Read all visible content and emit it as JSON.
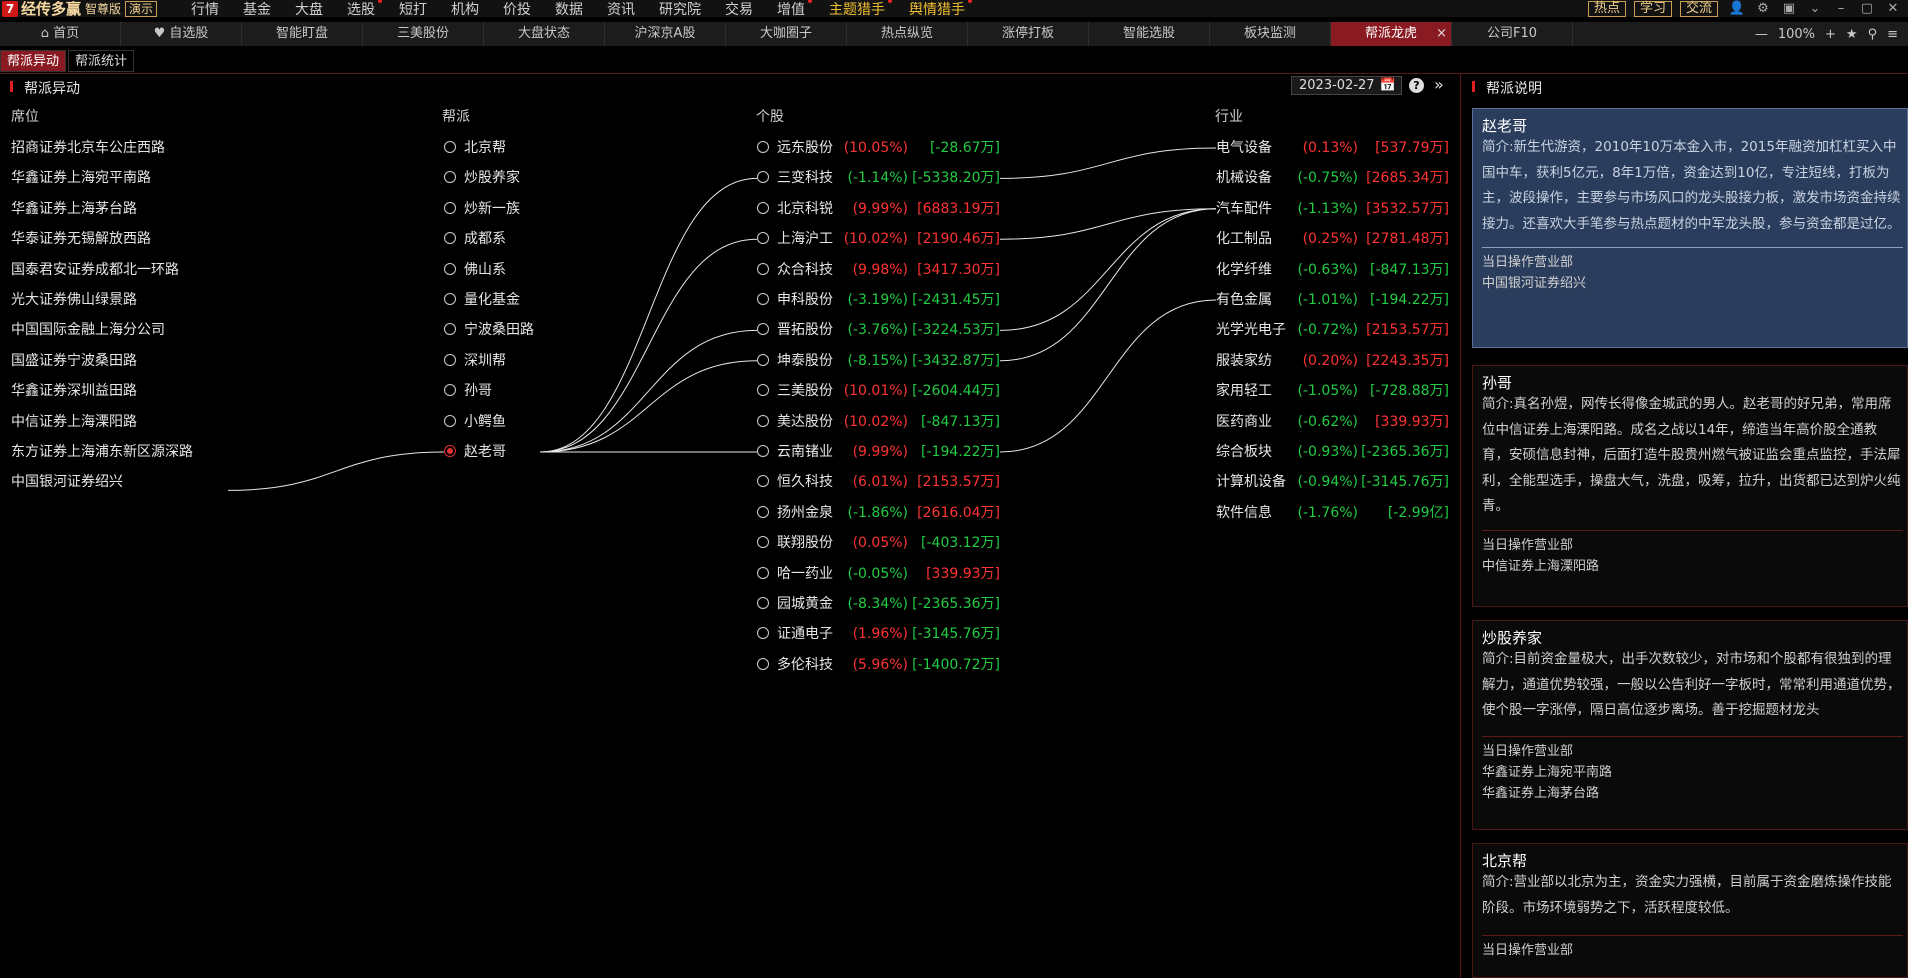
{
  "app": {
    "logo_mark": "7",
    "name": "经传多赢",
    "edition": "智尊版",
    "demo_label": "演示"
  },
  "menu": [
    {
      "label": "行情",
      "hot": false,
      "dot": false
    },
    {
      "label": "基金",
      "hot": false,
      "dot": false
    },
    {
      "label": "大盘",
      "hot": false,
      "dot": false
    },
    {
      "label": "选股",
      "hot": false,
      "dot": true
    },
    {
      "label": "短打",
      "hot": false,
      "dot": false
    },
    {
      "label": "机构",
      "hot": false,
      "dot": false
    },
    {
      "label": "价投",
      "hot": false,
      "dot": false
    },
    {
      "label": "数据",
      "hot": false,
      "dot": false
    },
    {
      "label": "资讯",
      "hot": false,
      "dot": false
    },
    {
      "label": "研究院",
      "hot": false,
      "dot": false
    },
    {
      "label": "交易",
      "hot": false,
      "dot": false
    },
    {
      "label": "增值",
      "hot": false,
      "dot": true
    },
    {
      "label": "主题猎手",
      "hot": true,
      "dot": true
    },
    {
      "label": "舆情猎手",
      "hot": true,
      "dot": true
    }
  ],
  "menu_right": {
    "buttons": [
      "热点",
      "学习",
      "交流"
    ]
  },
  "tabs": [
    {
      "label": "⌂ 首页",
      "active": false
    },
    {
      "label": "♥ 自选股",
      "active": false
    },
    {
      "label": "智能盯盘",
      "active": false
    },
    {
      "label": "三美股份",
      "active": false
    },
    {
      "label": "大盘状态",
      "active": false
    },
    {
      "label": "沪深京A股",
      "active": false
    },
    {
      "label": "大咖圈子",
      "active": false
    },
    {
      "label": "热点纵览",
      "active": false
    },
    {
      "label": "涨停打板",
      "active": false
    },
    {
      "label": "智能选股",
      "active": false
    },
    {
      "label": "板块监测",
      "active": false
    },
    {
      "label": "帮派龙虎",
      "active": true
    },
    {
      "label": "公司F10",
      "active": false
    }
  ],
  "tab_close": "×",
  "tab_zoom": "100%",
  "subtabs": [
    {
      "label": "帮派异动",
      "active": true
    },
    {
      "label": "帮派统计",
      "active": false
    }
  ],
  "panel": {
    "title": "帮派异动",
    "date": "2023-02-27",
    "help": "?",
    "collapse": "»"
  },
  "columns": {
    "seat": "席位",
    "gang": "帮派",
    "stock": "个股",
    "industry": "行业"
  },
  "seats": [
    "招商证券北京车公庄西路",
    "华鑫证券上海宛平南路",
    "华鑫证券上海茅台路",
    "华泰证券无锡解放西路",
    "国泰君安证券成都北一环路",
    "光大证券佛山绿景路",
    "中国国际金融上海分公司",
    "国盛证券宁波桑田路",
    "华鑫证券深圳益田路",
    "中信证券上海溧阳路",
    "东方证券上海浦东新区源深路",
    "中国银河证券绍兴"
  ],
  "gangs": [
    {
      "name": "北京帮",
      "selected": false
    },
    {
      "name": "炒股养家",
      "selected": false
    },
    {
      "name": "炒新一族",
      "selected": false
    },
    {
      "name": "成都系",
      "selected": false
    },
    {
      "name": "佛山系",
      "selected": false
    },
    {
      "name": "量化基金",
      "selected": false
    },
    {
      "name": "宁波桑田路",
      "selected": false
    },
    {
      "name": "深圳帮",
      "selected": false
    },
    {
      "name": "孙哥",
      "selected": false
    },
    {
      "name": "小鳄鱼",
      "selected": false
    },
    {
      "name": "赵老哥",
      "selected": true
    }
  ],
  "stocks": [
    {
      "name": "远东股份",
      "pct": "(10.05%)",
      "pct_up": true,
      "amt": "[-28.67万]",
      "amt_up": false
    },
    {
      "name": "三变科技",
      "pct": "(-1.14%)",
      "pct_up": false,
      "amt": "[-5338.20万]",
      "amt_up": false
    },
    {
      "name": "北京科锐",
      "pct": "(9.99%)",
      "pct_up": true,
      "amt": "[6883.19万]",
      "amt_up": true
    },
    {
      "name": "上海沪工",
      "pct": "(10.02%)",
      "pct_up": true,
      "amt": "[2190.46万]",
      "amt_up": true
    },
    {
      "name": "众合科技",
      "pct": "(9.98%)",
      "pct_up": true,
      "amt": "[3417.30万]",
      "amt_up": true
    },
    {
      "name": "申科股份",
      "pct": "(-3.19%)",
      "pct_up": false,
      "amt": "[-2431.45万]",
      "amt_up": false
    },
    {
      "name": "晋拓股份",
      "pct": "(-3.76%)",
      "pct_up": false,
      "amt": "[-3224.53万]",
      "amt_up": false
    },
    {
      "name": "坤泰股份",
      "pct": "(-8.15%)",
      "pct_up": false,
      "amt": "[-3432.87万]",
      "amt_up": false
    },
    {
      "name": "三美股份",
      "pct": "(10.01%)",
      "pct_up": true,
      "amt": "[-2604.44万]",
      "amt_up": false
    },
    {
      "name": "美达股份",
      "pct": "(10.02%)",
      "pct_up": true,
      "amt": "[-847.13万]",
      "amt_up": false
    },
    {
      "name": "云南锗业",
      "pct": "(9.99%)",
      "pct_up": true,
      "amt": "[-194.22万]",
      "amt_up": false
    },
    {
      "name": "恒久科技",
      "pct": "(6.01%)",
      "pct_up": true,
      "amt": "[2153.57万]",
      "amt_up": true
    },
    {
      "name": "扬州金泉",
      "pct": "(-1.86%)",
      "pct_up": false,
      "amt": "[2616.04万]",
      "amt_up": true
    },
    {
      "name": "联翔股份",
      "pct": "(0.05%)",
      "pct_up": true,
      "amt": "[-403.12万]",
      "amt_up": false
    },
    {
      "name": "哈一药业",
      "pct": "(-0.05%)",
      "pct_up": false,
      "amt": "[339.93万]",
      "amt_up": true
    },
    {
      "name": "园城黄金",
      "pct": "(-8.34%)",
      "pct_up": false,
      "amt": "[-2365.36万]",
      "amt_up": false
    },
    {
      "name": "证通电子",
      "pct": "(1.96%)",
      "pct_up": true,
      "amt": "[-3145.76万]",
      "amt_up": false
    },
    {
      "name": "多伦科技",
      "pct": "(5.96%)",
      "pct_up": true,
      "amt": "[-1400.72万]",
      "amt_up": false
    }
  ],
  "industries": [
    {
      "name": "电气设备",
      "pct": "(0.13%)",
      "pct_up": true,
      "amt": "[537.79万]",
      "amt_up": true
    },
    {
      "name": "机械设备",
      "pct": "(-0.75%)",
      "pct_up": false,
      "amt": "[2685.34万]",
      "amt_up": true
    },
    {
      "name": "汽车配件",
      "pct": "(-1.13%)",
      "pct_up": false,
      "amt": "[3532.57万]",
      "amt_up": true
    },
    {
      "name": "化工制品",
      "pct": "(0.25%)",
      "pct_up": true,
      "amt": "[2781.48万]",
      "amt_up": true
    },
    {
      "name": "化学纤维",
      "pct": "(-0.63%)",
      "pct_up": false,
      "amt": "[-847.13万]",
      "amt_up": false
    },
    {
      "name": "有色金属",
      "pct": "(-1.01%)",
      "pct_up": false,
      "amt": "[-194.22万]",
      "amt_up": false
    },
    {
      "name": "光学光电子",
      "pct": "(-0.72%)",
      "pct_up": false,
      "amt": "[2153.57万]",
      "amt_up": true
    },
    {
      "name": "服装家纺",
      "pct": "(0.20%)",
      "pct_up": true,
      "amt": "[2243.35万]",
      "amt_up": true
    },
    {
      "name": "家用轻工",
      "pct": "(-1.05%)",
      "pct_up": false,
      "amt": "[-728.88万]",
      "amt_up": false
    },
    {
      "name": "医药商业",
      "pct": "(-0.62%)",
      "pct_up": false,
      "amt": "[339.93万]",
      "amt_up": true
    },
    {
      "name": "综合板块",
      "pct": "(-0.93%)",
      "pct_up": false,
      "amt": "[-2365.36万]",
      "amt_up": false
    },
    {
      "name": "计算机设备",
      "pct": "(-0.94%)",
      "pct_up": false,
      "amt": "[-3145.76万]",
      "amt_up": false
    },
    {
      "name": "软件信息",
      "pct": "(-1.76%)",
      "pct_up": false,
      "amt": "[-2.99亿]",
      "amt_up": false
    }
  ],
  "links": {
    "seat_to_gang": [
      [
        11,
        10
      ]
    ],
    "gang_to_stock": [
      [
        10,
        1
      ],
      [
        10,
        3
      ],
      [
        10,
        6
      ],
      [
        10,
        7
      ],
      [
        10,
        10
      ]
    ],
    "stock_to_industry": [
      [
        1,
        0
      ],
      [
        3,
        2
      ],
      [
        6,
        2
      ],
      [
        7,
        2
      ],
      [
        10,
        5
      ]
    ]
  },
  "side": {
    "title": "帮派说明",
    "cards": [
      {
        "name": "赵老哥",
        "desc": "简介:新生代游资，2010年10万本金入市，2015年融资加杠杠买入中国中车，获利5亿元，8年1万倍，资金达到10亿，专注短线，打板为主，波段操作，主要参与市场风口的龙头股接力板，激发市场资金持续接力。还喜欢大手笔参与热点题材的中军龙头股，参与资金都是过亿。",
        "ops_label": "当日操作营业部",
        "ops": [
          "中国银河证券绍兴"
        ],
        "selected": true
      },
      {
        "name": "孙哥",
        "desc": "简介:真名孙煜，网传长得像金城武的男人。赵老哥的好兄弟，常用席位中信证券上海溧阳路。成名之战以14年，缔造当年高价股全通教育，安硕信息封神，后面打造牛股贵州燃气被证监会重点监控，手法犀利，全能型选手，操盘大气，洗盘，吸筹，拉升，出货都已达到炉火纯青。",
        "ops_label": "当日操作营业部",
        "ops": [
          "中信证券上海溧阳路"
        ],
        "selected": false
      },
      {
        "name": "炒股养家",
        "desc": "简介:目前资金量极大，出手次数较少，对市场和个股都有很独到的理解力，通道优势较强，一般以公告利好一字板时，常常利用通道优势，使个股一字涨停，隔日高位逐步离场。善于挖掘题材龙头",
        "ops_label": "当日操作营业部",
        "ops": [
          "华鑫证券上海宛平南路",
          "华鑫证券上海茅台路"
        ],
        "selected": false
      },
      {
        "name": "北京帮",
        "desc": "简介:营业部以北京为主，资金实力强横，目前属于资金磨炼操作技能阶段。市场环境弱势之下，活跃程度较低。",
        "ops_label": "当日操作营业部",
        "ops": [],
        "selected": false
      }
    ]
  }
}
